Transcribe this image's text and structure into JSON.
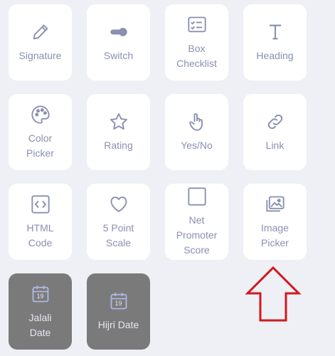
{
  "tiles": [
    {
      "label": "Signature",
      "icon": "pen-icon"
    },
    {
      "label": "Switch",
      "icon": "toggle-icon"
    },
    {
      "label": "Box\nChecklist",
      "icon": "checklist-icon"
    },
    {
      "label": "Heading",
      "icon": "heading-icon"
    },
    {
      "label": "Color\nPicker",
      "icon": "palette-icon"
    },
    {
      "label": "Rating",
      "icon": "star-icon"
    },
    {
      "label": "Yes/No",
      "icon": "pointer-hand-icon"
    },
    {
      "label": "Link",
      "icon": "link-icon"
    },
    {
      "label": "HTML\nCode",
      "icon": "code-icon"
    },
    {
      "label": "5 Point\nScale",
      "icon": "heart-icon"
    },
    {
      "label": "Net\nPromoter\nScore",
      "icon": "square-icon"
    },
    {
      "label": "Image\nPicker",
      "icon": "images-icon"
    },
    {
      "label": "Jalali\nDate",
      "icon": "calendar-icon",
      "calendar_day": "19"
    },
    {
      "label": "Hijri Date",
      "icon": "calendar-icon",
      "calendar_day": "19"
    }
  ],
  "colors": {
    "background": "#eef0f5",
    "tile": "#ffffff",
    "tile_disabled": "#7a7a7a",
    "icon": "#8990b0",
    "arrow": "#d0191f"
  }
}
